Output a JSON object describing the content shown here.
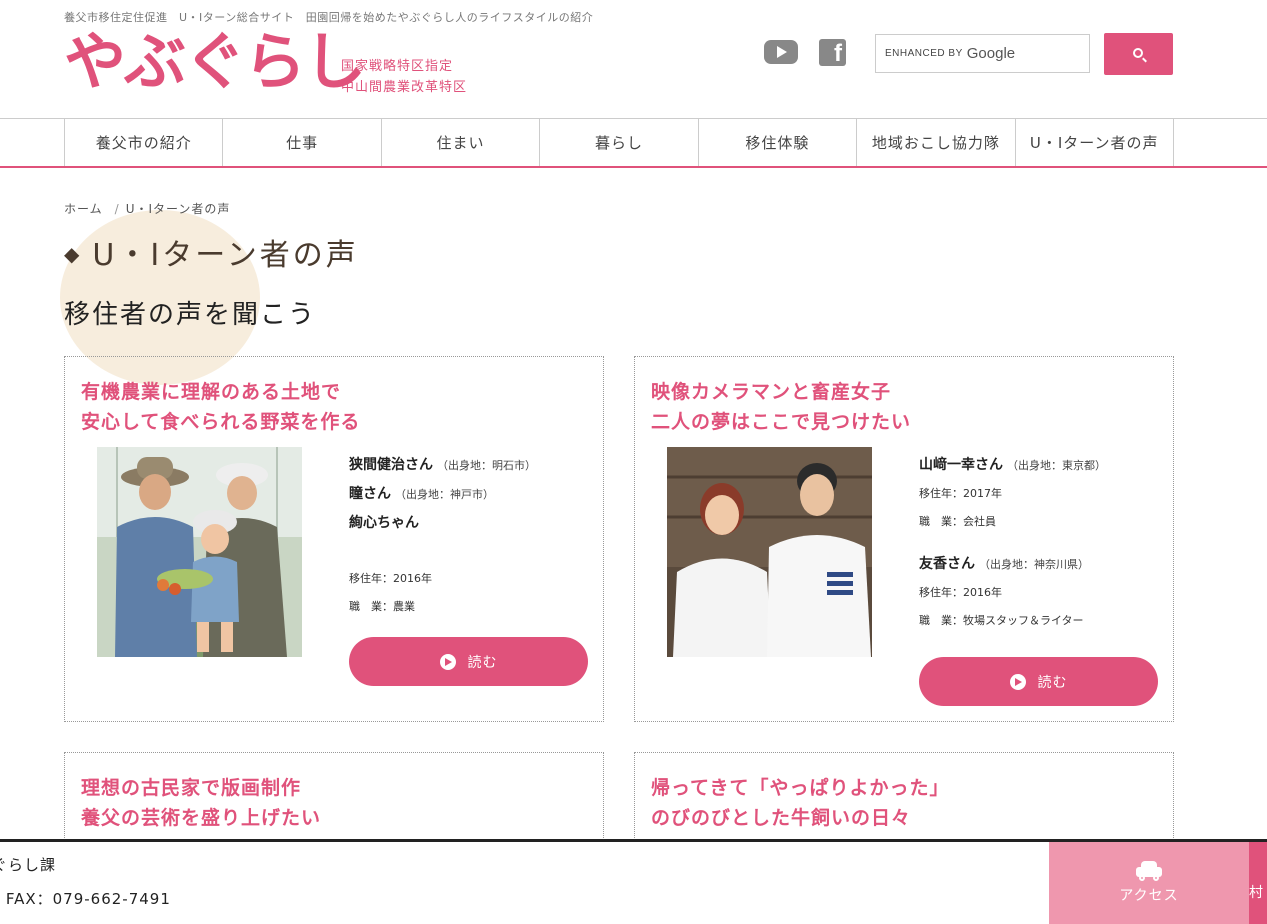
{
  "header": {
    "tagline": "養父市移住定住促進　U・Iターン総合サイト　田園回帰を始めたやぶぐらし人のライフスタイルの紹介",
    "logo_text": "やぶぐらし",
    "logo_sub_1": "国家戦略特区指定",
    "logo_sub_2": "中山間農業改革特区",
    "search": {
      "enhanced_by": "ENHANCED BY",
      "google": "Google"
    }
  },
  "nav": [
    {
      "label": "養父市の紹介"
    },
    {
      "label": "仕事"
    },
    {
      "label": "住まい"
    },
    {
      "label": "暮らし"
    },
    {
      "label": "移住体験"
    },
    {
      "label": "地域おこし協力隊"
    },
    {
      "label": "U・Iターン者の声"
    }
  ],
  "breadcrumb": {
    "home": "ホーム",
    "sep": "/",
    "current": "U・Iターン者の声"
  },
  "page": {
    "diamond": "◆",
    "title": "U・Iターン者の声",
    "subtitle": "移住者の声を聞こう"
  },
  "cards": [
    {
      "title_1": "有機農業に理解のある土地で",
      "title_2": "安心して食べられる野菜を作る",
      "people": [
        {
          "name": "狭間健治さん",
          "origin": "（出身地：明石市）"
        },
        {
          "name": "瞳さん",
          "origin": "（出身地：神戸市）"
        },
        {
          "name": "絢心ちゃん",
          "origin": ""
        }
      ],
      "year": "移住年：2016年",
      "job": "職　業：農業",
      "read": "読む"
    },
    {
      "title_1": "映像カメラマンと畜産女子",
      "title_2": "二人の夢はここで見つけたい",
      "person_a": {
        "name": "山﨑一幸さん",
        "origin": "（出身地：東京都）",
        "year": "移住年：2017年",
        "job": "職　業：会社員"
      },
      "person_b": {
        "name": "友香さん",
        "origin": "（出身地：神奈川県）",
        "year": "移住年：2016年",
        "job": "職　業：牧場スタッフ＆ライター"
      },
      "read": "読む"
    },
    {
      "title_1": "理想の古民家で版画制作",
      "title_2": "養父の芸術を盛り上げたい"
    },
    {
      "title_1": "帰ってきて「やっぱりよかった」",
      "title_2": "のびのびとした牛飼いの日々"
    }
  ],
  "footer": {
    "dept": "ぐらし課",
    "fax": "/  FAX：079-662-7491",
    "access": "アクセス",
    "next_tab": "村"
  },
  "colors": {
    "accent": "#e0527b",
    "accent_light": "#ef97ae",
    "deco": "#f6ead7"
  },
  "icons": [
    "youtube-icon",
    "facebook-icon",
    "search-icon",
    "arrow-circle-icon",
    "car-icon"
  ]
}
